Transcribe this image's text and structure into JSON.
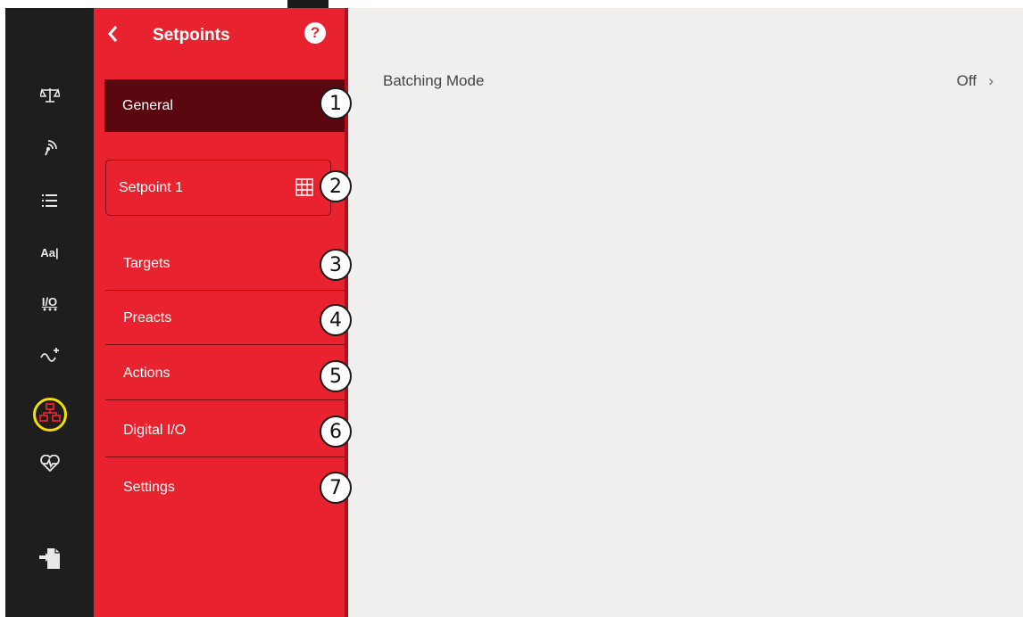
{
  "panel": {
    "title": "Setpoints",
    "help_glyph": "?",
    "general_label": "General",
    "setpoint_label": "Setpoint 1",
    "items": [
      {
        "label": "Targets"
      },
      {
        "label": "Preacts"
      },
      {
        "label": "Actions"
      },
      {
        "label": "Digital I/O"
      },
      {
        "label": "Settings"
      }
    ]
  },
  "callouts": [
    "1",
    "2",
    "3",
    "4",
    "5",
    "6",
    "7"
  ],
  "rail": {
    "icons": [
      "scale-icon",
      "wireless-icon",
      "list-icon",
      "text-format-icon",
      "io-icon",
      "signal-icon",
      "setpoints-network-icon",
      "heartbeat-icon",
      "export-icon"
    ],
    "text_icon_label": "Aa|",
    "io_label": "I/O"
  },
  "content": {
    "rows": [
      {
        "label": "Batching Mode",
        "value": "Off",
        "chevron": "›"
      }
    ]
  },
  "colors": {
    "rail_bg": "#1e1e1e",
    "panel_bg": "#e8222e",
    "selected_bg": "#5a0710",
    "content_bg": "#f1efed",
    "active_ring": "#f3e000"
  }
}
